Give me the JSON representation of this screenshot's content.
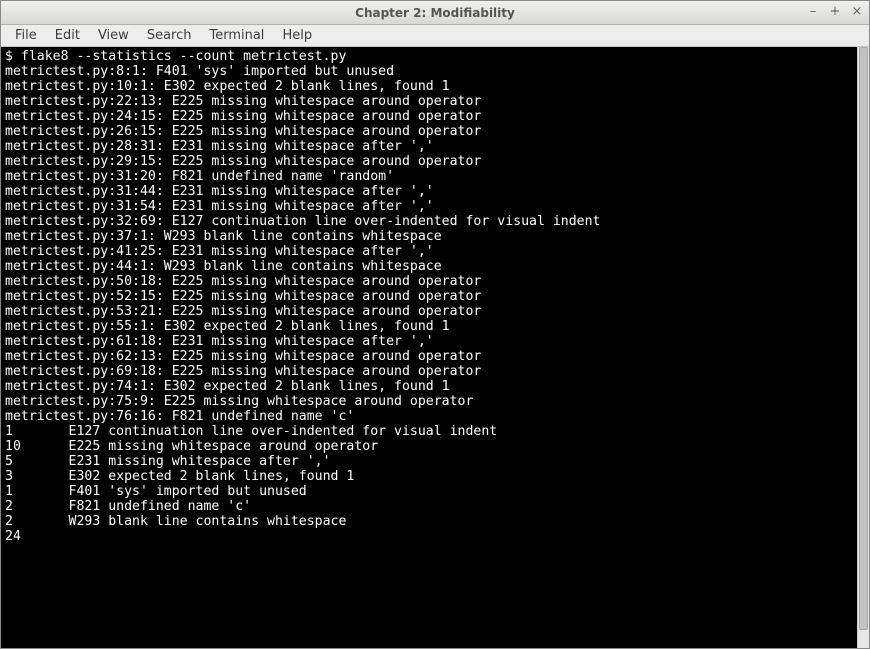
{
  "window": {
    "title": "Chapter 2: Modifiability",
    "controls": {
      "minimize": "–",
      "maximize": "+",
      "close": "×"
    }
  },
  "menubar": {
    "items": [
      "File",
      "Edit",
      "View",
      "Search",
      "Terminal",
      "Help"
    ]
  },
  "terminal": {
    "prompt": "$ ",
    "command": "flake8 --statistics --count metrictest.py",
    "output_lines": [
      "metrictest.py:8:1: F401 'sys' imported but unused",
      "metrictest.py:10:1: E302 expected 2 blank lines, found 1",
      "metrictest.py:22:13: E225 missing whitespace around operator",
      "metrictest.py:24:15: E225 missing whitespace around operator",
      "metrictest.py:26:15: E225 missing whitespace around operator",
      "metrictest.py:28:31: E231 missing whitespace after ','",
      "metrictest.py:29:15: E225 missing whitespace around operator",
      "metrictest.py:31:20: F821 undefined name 'random'",
      "metrictest.py:31:44: E231 missing whitespace after ','",
      "metrictest.py:31:54: E231 missing whitespace after ','",
      "metrictest.py:32:69: E127 continuation line over-indented for visual indent",
      "metrictest.py:37:1: W293 blank line contains whitespace",
      "metrictest.py:41:25: E231 missing whitespace after ','",
      "metrictest.py:44:1: W293 blank line contains whitespace",
      "metrictest.py:50:18: E225 missing whitespace around operator",
      "metrictest.py:52:15: E225 missing whitespace around operator",
      "metrictest.py:53:21: E225 missing whitespace around operator",
      "metrictest.py:55:1: E302 expected 2 blank lines, found 1",
      "metrictest.py:61:18: E231 missing whitespace after ','",
      "metrictest.py:62:13: E225 missing whitespace around operator",
      "metrictest.py:69:18: E225 missing whitespace around operator",
      "metrictest.py:74:1: E302 expected 2 blank lines, found 1",
      "metrictest.py:75:9: E225 missing whitespace around operator",
      "metrictest.py:76:16: F821 undefined name 'c'",
      "1       E127 continuation line over-indented for visual indent",
      "10      E225 missing whitespace around operator",
      "5       E231 missing whitespace after ','",
      "3       E302 expected 2 blank lines, found 1",
      "1       F401 'sys' imported but unused",
      "2       F821 undefined name 'c'",
      "2       W293 blank line contains whitespace",
      "24"
    ]
  }
}
